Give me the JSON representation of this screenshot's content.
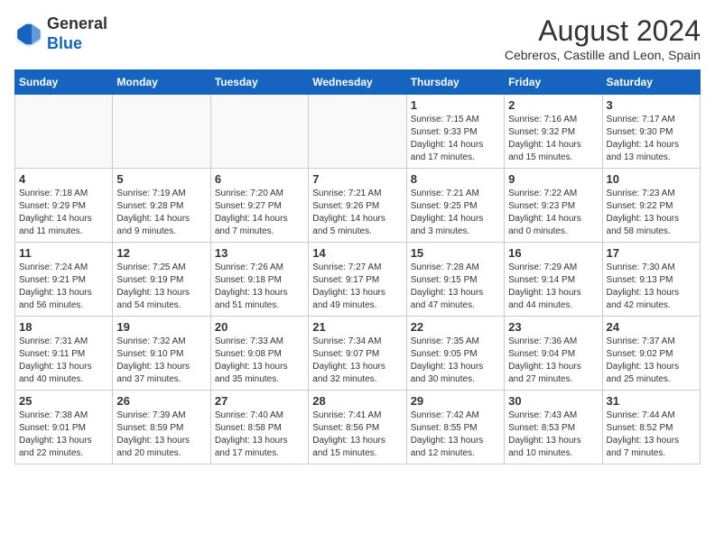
{
  "header": {
    "logo_general": "General",
    "logo_blue": "Blue",
    "month_year": "August 2024",
    "location": "Cebreros, Castille and Leon, Spain"
  },
  "weekdays": [
    "Sunday",
    "Monday",
    "Tuesday",
    "Wednesday",
    "Thursday",
    "Friday",
    "Saturday"
  ],
  "weeks": [
    [
      {
        "num": "",
        "info": ""
      },
      {
        "num": "",
        "info": ""
      },
      {
        "num": "",
        "info": ""
      },
      {
        "num": "",
        "info": ""
      },
      {
        "num": "1",
        "info": "Sunrise: 7:15 AM\nSunset: 9:33 PM\nDaylight: 14 hours\nand 17 minutes."
      },
      {
        "num": "2",
        "info": "Sunrise: 7:16 AM\nSunset: 9:32 PM\nDaylight: 14 hours\nand 15 minutes."
      },
      {
        "num": "3",
        "info": "Sunrise: 7:17 AM\nSunset: 9:30 PM\nDaylight: 14 hours\nand 13 minutes."
      }
    ],
    [
      {
        "num": "4",
        "info": "Sunrise: 7:18 AM\nSunset: 9:29 PM\nDaylight: 14 hours\nand 11 minutes."
      },
      {
        "num": "5",
        "info": "Sunrise: 7:19 AM\nSunset: 9:28 PM\nDaylight: 14 hours\nand 9 minutes."
      },
      {
        "num": "6",
        "info": "Sunrise: 7:20 AM\nSunset: 9:27 PM\nDaylight: 14 hours\nand 7 minutes."
      },
      {
        "num": "7",
        "info": "Sunrise: 7:21 AM\nSunset: 9:26 PM\nDaylight: 14 hours\nand 5 minutes."
      },
      {
        "num": "8",
        "info": "Sunrise: 7:21 AM\nSunset: 9:25 PM\nDaylight: 14 hours\nand 3 minutes."
      },
      {
        "num": "9",
        "info": "Sunrise: 7:22 AM\nSunset: 9:23 PM\nDaylight: 14 hours\nand 0 minutes."
      },
      {
        "num": "10",
        "info": "Sunrise: 7:23 AM\nSunset: 9:22 PM\nDaylight: 13 hours\nand 58 minutes."
      }
    ],
    [
      {
        "num": "11",
        "info": "Sunrise: 7:24 AM\nSunset: 9:21 PM\nDaylight: 13 hours\nand 56 minutes."
      },
      {
        "num": "12",
        "info": "Sunrise: 7:25 AM\nSunset: 9:19 PM\nDaylight: 13 hours\nand 54 minutes."
      },
      {
        "num": "13",
        "info": "Sunrise: 7:26 AM\nSunset: 9:18 PM\nDaylight: 13 hours\nand 51 minutes."
      },
      {
        "num": "14",
        "info": "Sunrise: 7:27 AM\nSunset: 9:17 PM\nDaylight: 13 hours\nand 49 minutes."
      },
      {
        "num": "15",
        "info": "Sunrise: 7:28 AM\nSunset: 9:15 PM\nDaylight: 13 hours\nand 47 minutes."
      },
      {
        "num": "16",
        "info": "Sunrise: 7:29 AM\nSunset: 9:14 PM\nDaylight: 13 hours\nand 44 minutes."
      },
      {
        "num": "17",
        "info": "Sunrise: 7:30 AM\nSunset: 9:13 PM\nDaylight: 13 hours\nand 42 minutes."
      }
    ],
    [
      {
        "num": "18",
        "info": "Sunrise: 7:31 AM\nSunset: 9:11 PM\nDaylight: 13 hours\nand 40 minutes."
      },
      {
        "num": "19",
        "info": "Sunrise: 7:32 AM\nSunset: 9:10 PM\nDaylight: 13 hours\nand 37 minutes."
      },
      {
        "num": "20",
        "info": "Sunrise: 7:33 AM\nSunset: 9:08 PM\nDaylight: 13 hours\nand 35 minutes."
      },
      {
        "num": "21",
        "info": "Sunrise: 7:34 AM\nSunset: 9:07 PM\nDaylight: 13 hours\nand 32 minutes."
      },
      {
        "num": "22",
        "info": "Sunrise: 7:35 AM\nSunset: 9:05 PM\nDaylight: 13 hours\nand 30 minutes."
      },
      {
        "num": "23",
        "info": "Sunrise: 7:36 AM\nSunset: 9:04 PM\nDaylight: 13 hours\nand 27 minutes."
      },
      {
        "num": "24",
        "info": "Sunrise: 7:37 AM\nSunset: 9:02 PM\nDaylight: 13 hours\nand 25 minutes."
      }
    ],
    [
      {
        "num": "25",
        "info": "Sunrise: 7:38 AM\nSunset: 9:01 PM\nDaylight: 13 hours\nand 22 minutes."
      },
      {
        "num": "26",
        "info": "Sunrise: 7:39 AM\nSunset: 8:59 PM\nDaylight: 13 hours\nand 20 minutes."
      },
      {
        "num": "27",
        "info": "Sunrise: 7:40 AM\nSunset: 8:58 PM\nDaylight: 13 hours\nand 17 minutes."
      },
      {
        "num": "28",
        "info": "Sunrise: 7:41 AM\nSunset: 8:56 PM\nDaylight: 13 hours\nand 15 minutes."
      },
      {
        "num": "29",
        "info": "Sunrise: 7:42 AM\nSunset: 8:55 PM\nDaylight: 13 hours\nand 12 minutes."
      },
      {
        "num": "30",
        "info": "Sunrise: 7:43 AM\nSunset: 8:53 PM\nDaylight: 13 hours\nand 10 minutes."
      },
      {
        "num": "31",
        "info": "Sunrise: 7:44 AM\nSunset: 8:52 PM\nDaylight: 13 hours\nand 7 minutes."
      }
    ]
  ]
}
